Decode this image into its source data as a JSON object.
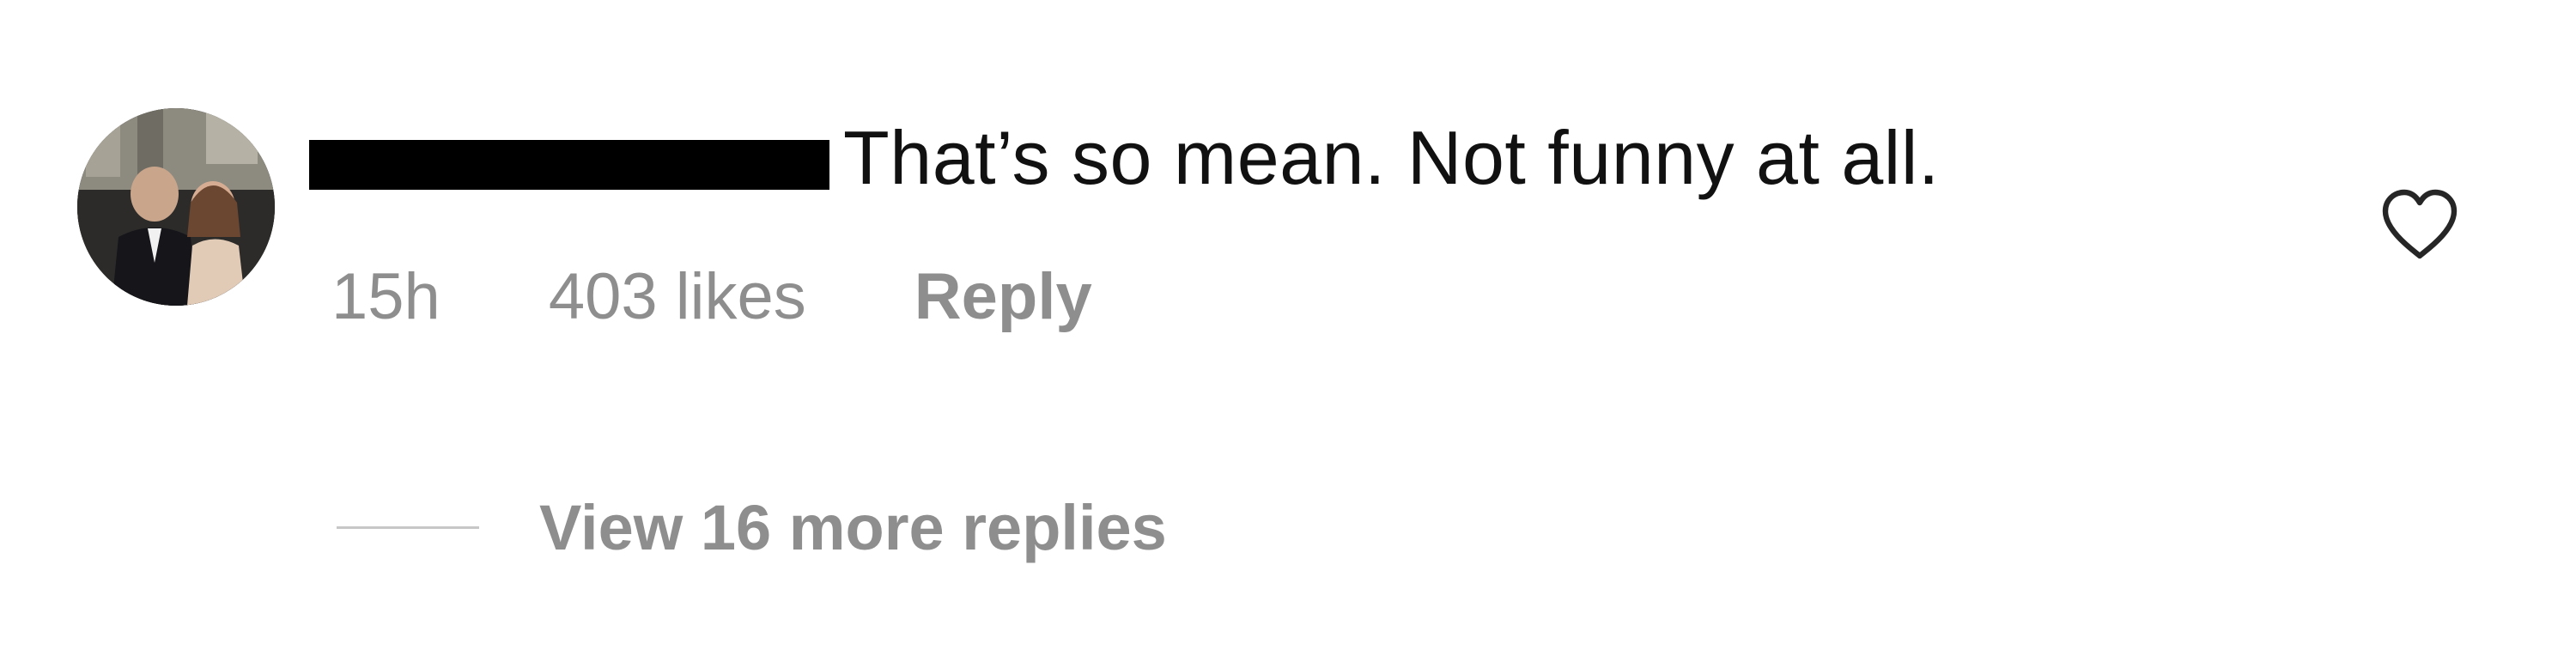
{
  "comment": {
    "avatar_icon": "profile-photo-couple",
    "username": "",
    "text": "That’s so mean. Not funny at all.",
    "time": "15h",
    "likes": "403 likes",
    "reply_label": "Reply",
    "like_icon": "heart-outline-icon",
    "view_replies_label": "View 16 more replies"
  },
  "colors": {
    "text_primary": "#111111",
    "text_secondary": "#8e8e8e",
    "divider": "#c7c7c7",
    "redaction": "#000000"
  }
}
